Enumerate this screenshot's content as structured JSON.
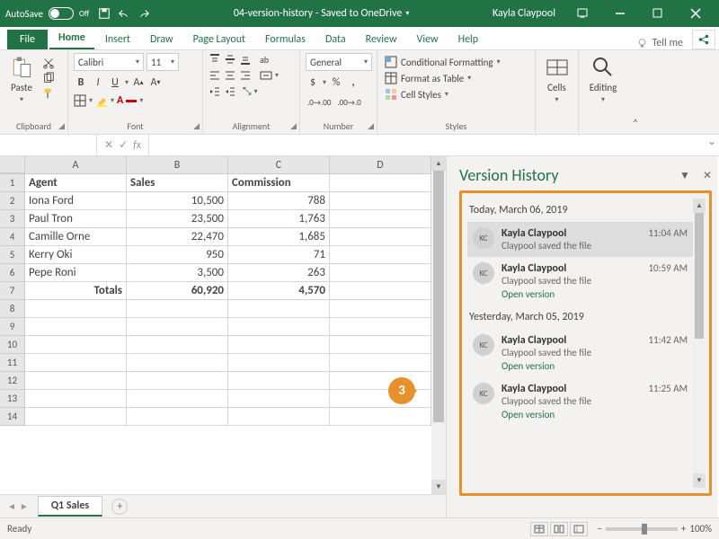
{
  "title": {
    "autosave": "AutoSave",
    "off": "Off",
    "doc": "04-version-history - Saved to OneDrive",
    "user": "Kayla Claypool"
  },
  "tabs": {
    "file": "File",
    "home": "Home",
    "insert": "Insert",
    "draw": "Draw",
    "pagelayout": "Page Layout",
    "formulas": "Formulas",
    "data": "Data",
    "review": "Review",
    "view": "View",
    "help": "Help",
    "tellme": "Tell me"
  },
  "ribbon": {
    "clipboard": {
      "paste": "Paste",
      "label": "Clipboard"
    },
    "font": {
      "name": "Calibri",
      "size": "11",
      "label": "Font"
    },
    "alignment": {
      "label": "Alignment"
    },
    "number": {
      "format": "General",
      "label": "Number"
    },
    "styles": {
      "cond": "Conditional Formatting",
      "table": "Format as Table",
      "cell": "Cell Styles",
      "label": "Styles"
    },
    "cells": {
      "label": "Cells"
    },
    "editing": {
      "label": "Editing"
    }
  },
  "formula": {
    "fx": "fx"
  },
  "sheet": {
    "cols": [
      "A",
      "B",
      "C",
      "D"
    ],
    "rows": [
      "1",
      "2",
      "3",
      "4",
      "5",
      "6",
      "7",
      "8",
      "9",
      "10",
      "11",
      "12",
      "13",
      "14"
    ],
    "data": [
      [
        "Agent",
        "Sales",
        "Commission",
        ""
      ],
      [
        "Iona Ford",
        "10,500",
        "788",
        ""
      ],
      [
        "Paul Tron",
        "23,500",
        "1,763",
        ""
      ],
      [
        "Camille Orne",
        "22,470",
        "1,685",
        ""
      ],
      [
        "Kerry Oki",
        "950",
        "71",
        ""
      ],
      [
        "Pepe Roni",
        "3,500",
        "263",
        ""
      ],
      [
        "Totals",
        "60,920",
        "4,570",
        ""
      ]
    ],
    "tab": "Q1 Sales"
  },
  "status": {
    "ready": "Ready",
    "zoom": "100%"
  },
  "pane": {
    "title": "Version History",
    "today": "Today, March 06, 2019",
    "yesterday": "Yesterday, March 05, 2019",
    "versions": [
      {
        "avatar": "KC",
        "name": "Kayla Claypool",
        "act": "Claypool saved the file",
        "time": "11:04 AM",
        "sel": true,
        "open": false
      },
      {
        "avatar": "KC",
        "name": "Kayla Claypool",
        "act": "Claypool saved the file",
        "time": "10:59 AM",
        "sel": false,
        "open": true
      }
    ],
    "versions2": [
      {
        "avatar": "KC",
        "name": "Kayla Claypool",
        "act": "Claypool saved the file",
        "time": "11:42 AM",
        "open": true
      },
      {
        "avatar": "KC",
        "name": "Kayla Claypool",
        "act": "Claypool saved the file",
        "time": "11:25 AM",
        "open": true
      }
    ],
    "open": "Open version"
  },
  "callout": "3"
}
